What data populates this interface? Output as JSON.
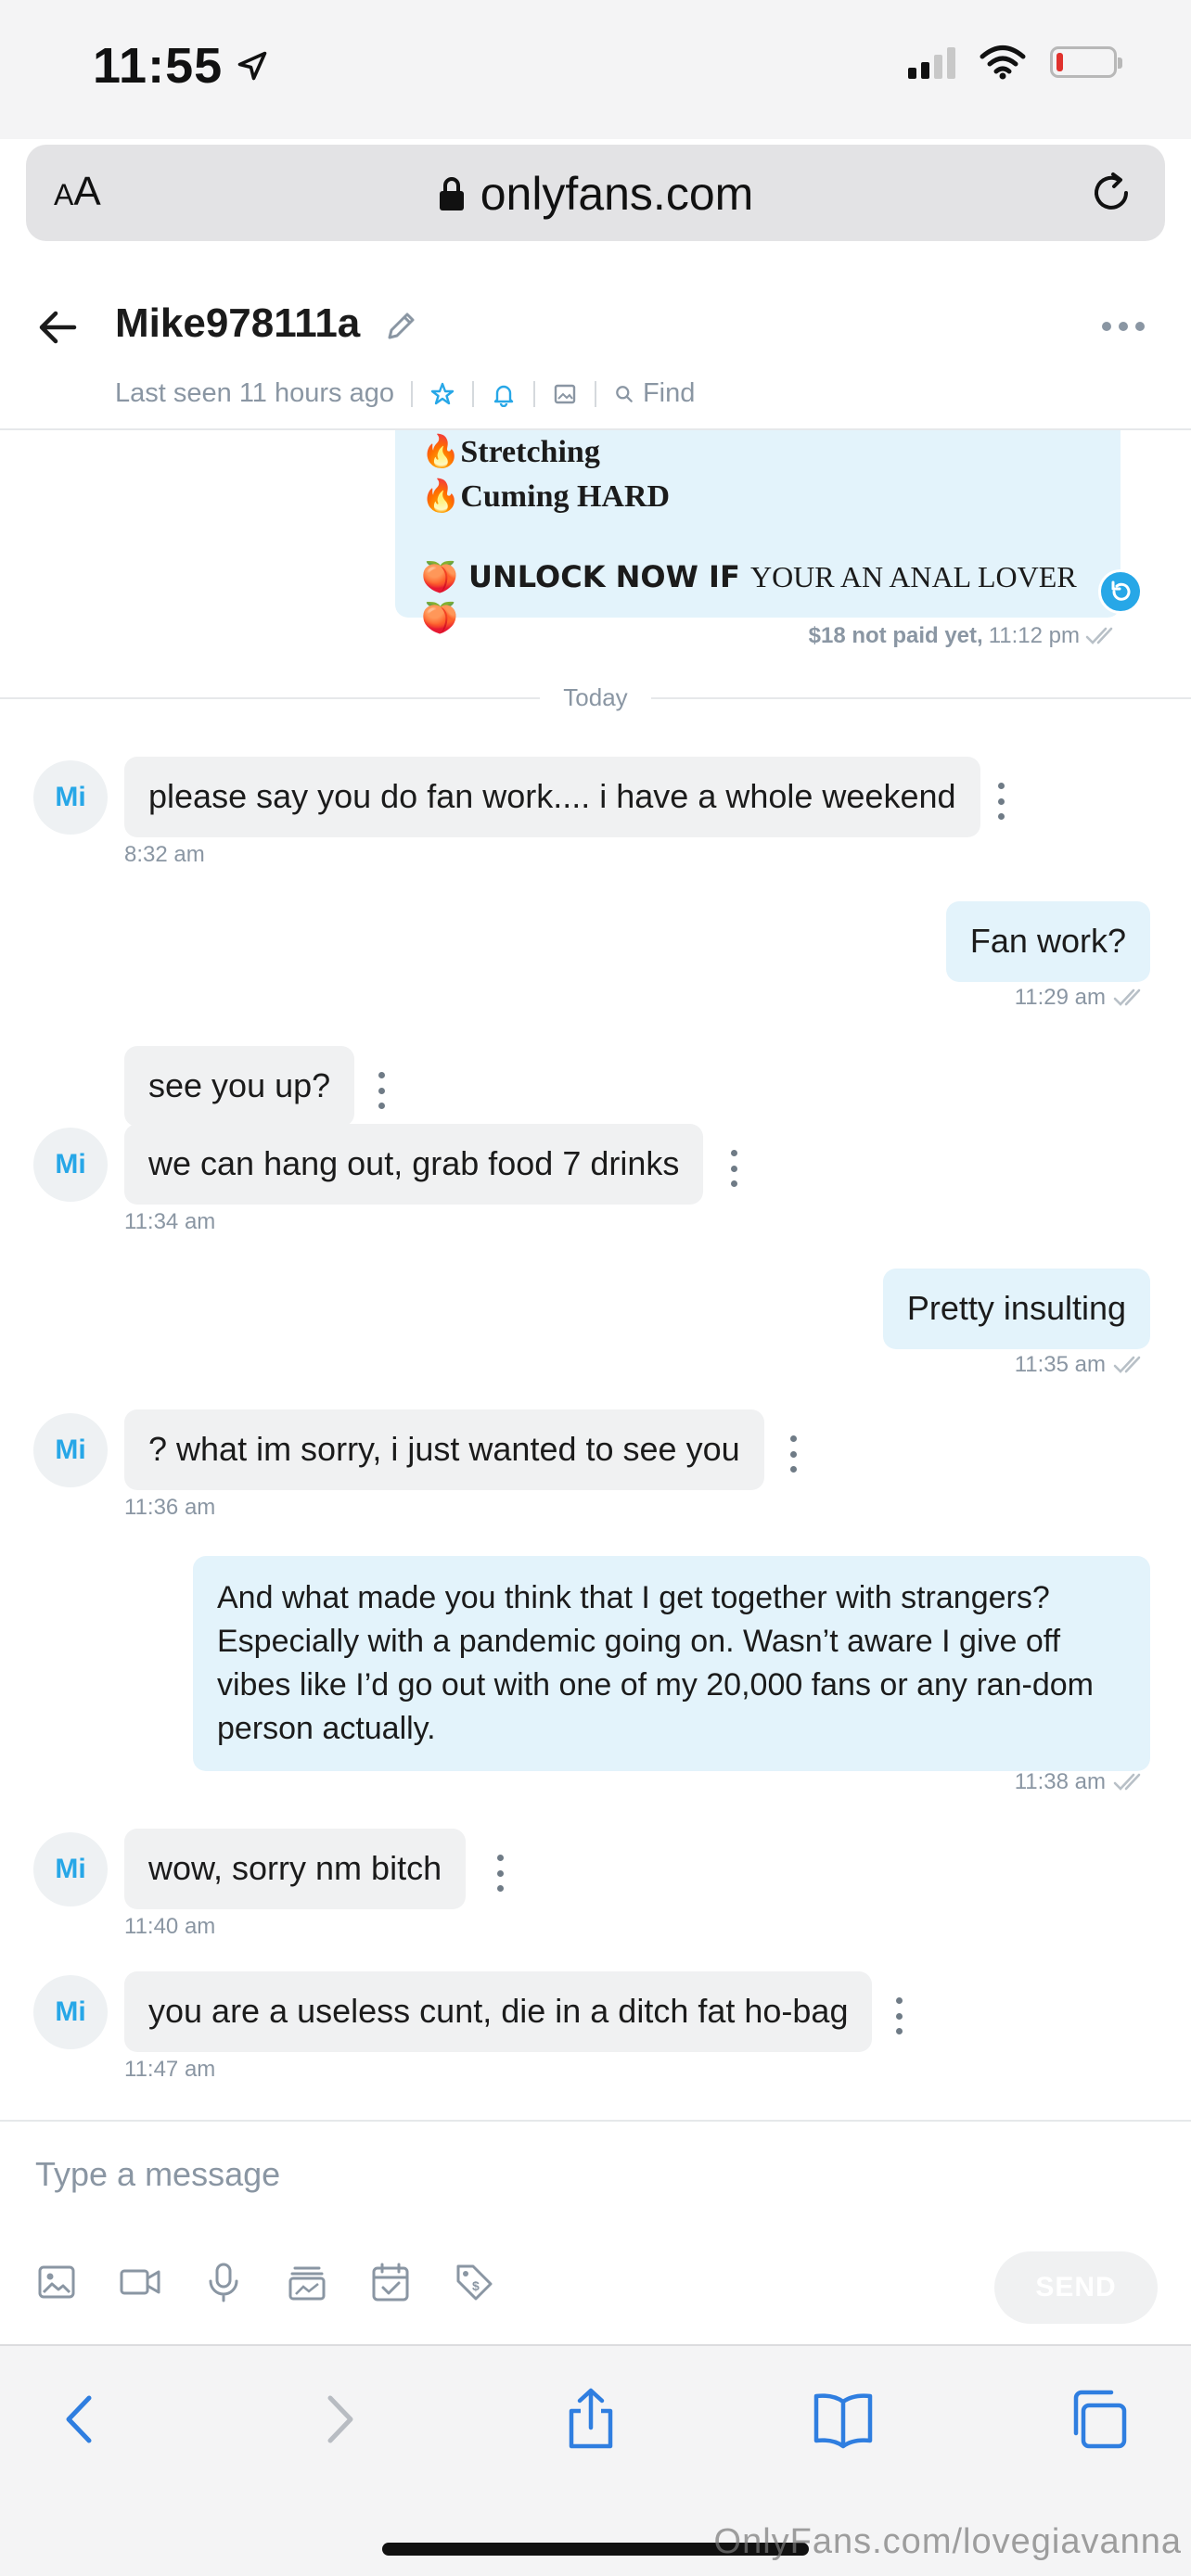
{
  "status_bar": {
    "time": "11:55",
    "battery_level": 0.12,
    "battery_color": "#e0322d"
  },
  "url_bar": {
    "aa_label": "AA",
    "url": "onlyfans.com"
  },
  "chat_header": {
    "username": "Mike978111a",
    "last_seen": "Last seen 11 hours ago",
    "find_label": "Find"
  },
  "ppv_message": {
    "line1": "Stretching",
    "line2": "Cuming HARD",
    "unlock_bold": "UNLOCK NOW IF",
    "unlock_rest": "YOUR AN ANAL LOVER",
    "price_status": "$18 not paid yet,",
    "time": "11:12 pm"
  },
  "date_divider": "Today",
  "messages": [
    {
      "direction": "in",
      "avatar": "Mi",
      "text": "please say you do fan work.... i have a whole weekend",
      "time": "8:32 am"
    },
    {
      "direction": "out",
      "text": "Fan work?",
      "time": "11:29 am"
    },
    {
      "direction": "in",
      "text": "see you up?"
    },
    {
      "direction": "in",
      "avatar": "Mi",
      "text": "we can hang out, grab food 7 drinks",
      "time": "11:34 am"
    },
    {
      "direction": "out",
      "text": "Pretty insulting",
      "time": "11:35 am"
    },
    {
      "direction": "in",
      "avatar": "Mi",
      "text": "? what im sorry, i just wanted to see you",
      "time": "11:36 am"
    },
    {
      "direction": "out",
      "text": "And what made you think that I get together with strangers? Especially with a pandemic going on. Wasn’t aware I give off vibes like I’d go out with one of my 20,000 fans or any ran-dom person actually.",
      "time": "11:38 am"
    },
    {
      "direction": "in",
      "avatar": "Mi",
      "text": "wow, sorry nm bitch",
      "time": "11:40 am"
    },
    {
      "direction": "in",
      "avatar": "Mi",
      "text": "you are a useless cunt, die in a ditch fat ho-bag",
      "time": "11:47 am"
    }
  ],
  "composer": {
    "placeholder": "Type a message",
    "send_label": "SEND",
    "tools": [
      "image-icon",
      "video-icon",
      "microphone-icon",
      "vault-icon",
      "schedule-icon",
      "price-tag-icon"
    ]
  },
  "safari_toolbar": {
    "buttons": [
      "back-icon",
      "forward-icon",
      "share-icon",
      "bookmarks-icon",
      "tabs-icon"
    ]
  },
  "watermark": "OnlyFans.com/lovegiavanna",
  "colors": {
    "accent": "#27a7e7",
    "incoming_bubble": "#f0f1f2",
    "outgoing_bubble": "#e3f3fb",
    "muted_text": "#8a96a3"
  }
}
